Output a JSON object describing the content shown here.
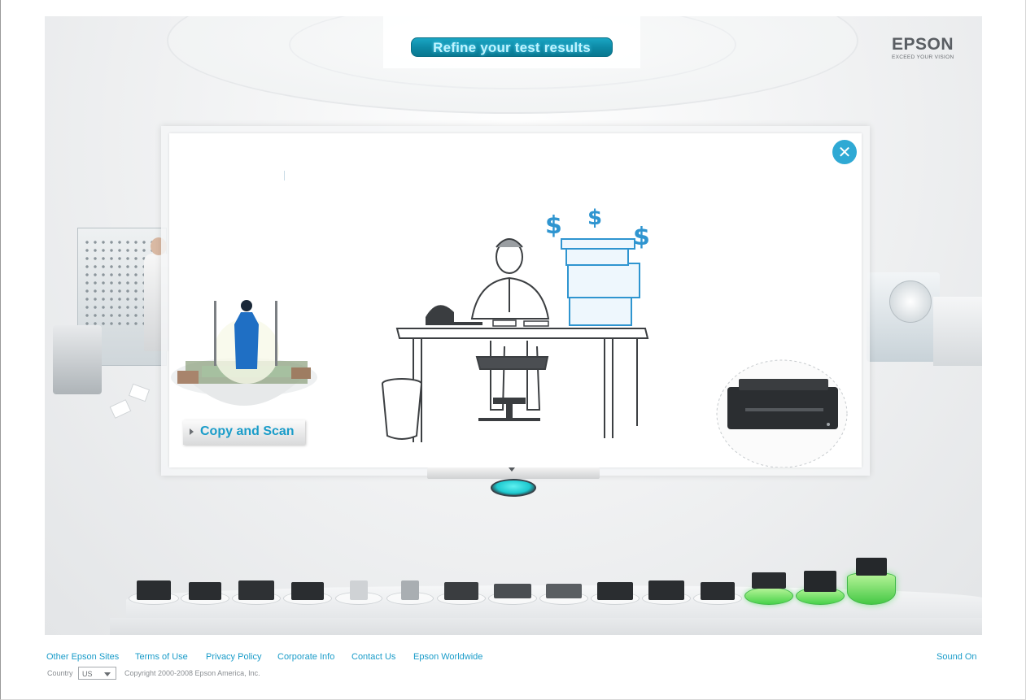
{
  "header": {
    "refine_label": "Refine your test results"
  },
  "brand": {
    "name": "EPSON",
    "tagline": "EXCEED YOUR VISION",
    "accent_color": "#1a9cc9"
  },
  "modal": {
    "close_icon": "close-icon",
    "copy_scan_label": "Copy and Scan"
  },
  "footer": {
    "links": [
      "Other Epson Sites",
      "Terms of Use",
      "Privacy Policy",
      "Corporate Info",
      "Contact Us",
      "Epson Worldwide"
    ],
    "sound_label": "Sound On",
    "country_label": "Country",
    "country_value": "US",
    "copyright": "Copyright  2000-2008 Epson America, Inc."
  }
}
